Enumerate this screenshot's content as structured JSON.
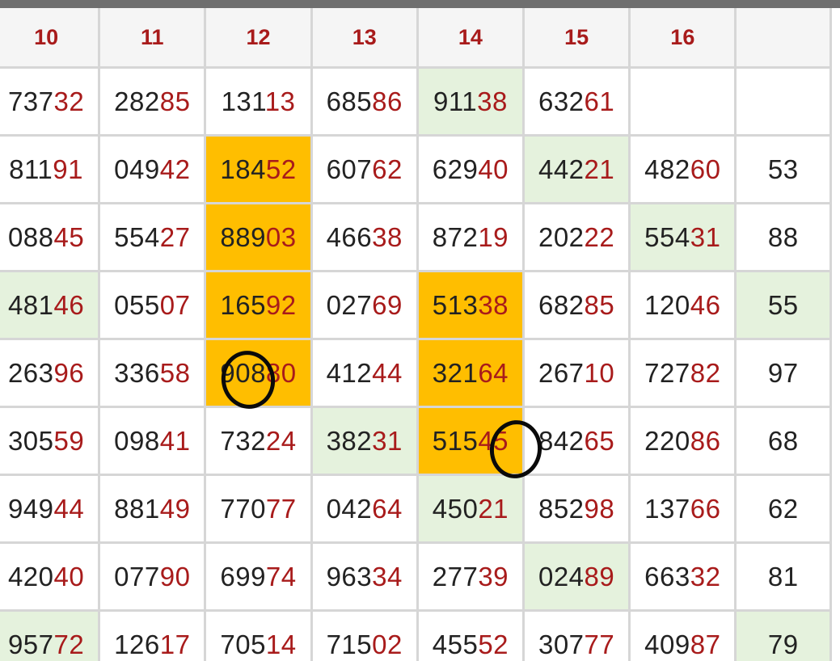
{
  "table": {
    "columns": [
      {
        "label": "10"
      },
      {
        "label": "11"
      },
      {
        "label": "12"
      },
      {
        "label": "13"
      },
      {
        "label": "14"
      },
      {
        "label": "15"
      },
      {
        "label": "16"
      },
      {
        "label": ""
      }
    ],
    "rows": [
      {
        "cells": [
          {
            "head": "737",
            "tail": "32",
            "hl": ""
          },
          {
            "head": "282",
            "tail": "85",
            "hl": ""
          },
          {
            "head": "131",
            "tail": "13",
            "hl": ""
          },
          {
            "head": "685",
            "tail": "86",
            "hl": ""
          },
          {
            "head": "911",
            "tail": "38",
            "hl": "green"
          },
          {
            "head": "632",
            "tail": "61",
            "hl": ""
          },
          {
            "head": "",
            "tail": "",
            "hl": ""
          },
          {
            "head": "",
            "tail": "",
            "hl": ""
          }
        ]
      },
      {
        "cells": [
          {
            "head": "811",
            "tail": "91",
            "hl": ""
          },
          {
            "head": "049",
            "tail": "42",
            "hl": ""
          },
          {
            "head": "184",
            "tail": "52",
            "hl": "orange"
          },
          {
            "head": "607",
            "tail": "62",
            "hl": ""
          },
          {
            "head": "629",
            "tail": "40",
            "hl": ""
          },
          {
            "head": "442",
            "tail": "21",
            "hl": "green"
          },
          {
            "head": "482",
            "tail": "60",
            "hl": ""
          },
          {
            "head": "53",
            "tail": "",
            "hl": ""
          }
        ]
      },
      {
        "cells": [
          {
            "head": "088",
            "tail": "45",
            "hl": ""
          },
          {
            "head": "554",
            "tail": "27",
            "hl": ""
          },
          {
            "head": "889",
            "tail": "03",
            "hl": "orange"
          },
          {
            "head": "466",
            "tail": "38",
            "hl": ""
          },
          {
            "head": "872",
            "tail": "19",
            "hl": ""
          },
          {
            "head": "202",
            "tail": "22",
            "hl": ""
          },
          {
            "head": "554",
            "tail": "31",
            "hl": "green"
          },
          {
            "head": "88",
            "tail": "",
            "hl": ""
          }
        ]
      },
      {
        "cells": [
          {
            "head": "481",
            "tail": "46",
            "hl": "green"
          },
          {
            "head": "055",
            "tail": "07",
            "hl": ""
          },
          {
            "head": "165",
            "tail": "92",
            "hl": "orange"
          },
          {
            "head": "027",
            "tail": "69",
            "hl": ""
          },
          {
            "head": "513",
            "tail": "38",
            "hl": "orange"
          },
          {
            "head": "682",
            "tail": "85",
            "hl": ""
          },
          {
            "head": "120",
            "tail": "46",
            "hl": ""
          },
          {
            "head": "55",
            "tail": "",
            "hl": "green"
          }
        ]
      },
      {
        "cells": [
          {
            "head": "263",
            "tail": "96",
            "hl": ""
          },
          {
            "head": "336",
            "tail": "58",
            "hl": ""
          },
          {
            "head": "908",
            "tail": "80",
            "hl": "orange"
          },
          {
            "head": "412",
            "tail": "44",
            "hl": ""
          },
          {
            "head": "321",
            "tail": "64",
            "hl": "orange"
          },
          {
            "head": "267",
            "tail": "10",
            "hl": ""
          },
          {
            "head": "727",
            "tail": "82",
            "hl": ""
          },
          {
            "head": "97",
            "tail": "",
            "hl": ""
          }
        ]
      },
      {
        "cells": [
          {
            "head": "305",
            "tail": "59",
            "hl": ""
          },
          {
            "head": "098",
            "tail": "41",
            "hl": ""
          },
          {
            "head": "732",
            "tail": "24",
            "hl": ""
          },
          {
            "head": "382",
            "tail": "31",
            "hl": "green"
          },
          {
            "head": "515",
            "tail": "45",
            "hl": "orange"
          },
          {
            "head": "842",
            "tail": "65",
            "hl": ""
          },
          {
            "head": "220",
            "tail": "86",
            "hl": ""
          },
          {
            "head": "68",
            "tail": "",
            "hl": ""
          }
        ]
      },
      {
        "cells": [
          {
            "head": "949",
            "tail": "44",
            "hl": ""
          },
          {
            "head": "881",
            "tail": "49",
            "hl": ""
          },
          {
            "head": "770",
            "tail": "77",
            "hl": ""
          },
          {
            "head": "042",
            "tail": "64",
            "hl": ""
          },
          {
            "head": "450",
            "tail": "21",
            "hl": "green"
          },
          {
            "head": "852",
            "tail": "98",
            "hl": ""
          },
          {
            "head": "137",
            "tail": "66",
            "hl": ""
          },
          {
            "head": "62",
            "tail": "",
            "hl": ""
          }
        ]
      },
      {
        "cells": [
          {
            "head": "420",
            "tail": "40",
            "hl": ""
          },
          {
            "head": "077",
            "tail": "90",
            "hl": ""
          },
          {
            "head": "699",
            "tail": "74",
            "hl": ""
          },
          {
            "head": "963",
            "tail": "34",
            "hl": ""
          },
          {
            "head": "277",
            "tail": "39",
            "hl": ""
          },
          {
            "head": "024",
            "tail": "89",
            "hl": "green"
          },
          {
            "head": "663",
            "tail": "32",
            "hl": ""
          },
          {
            "head": "81",
            "tail": "",
            "hl": ""
          }
        ]
      },
      {
        "cells": [
          {
            "head": "957",
            "tail": "72",
            "hl": "green"
          },
          {
            "head": "126",
            "tail": "17",
            "hl": ""
          },
          {
            "head": "705",
            "tail": "14",
            "hl": ""
          },
          {
            "head": "715",
            "tail": "02",
            "hl": ""
          },
          {
            "head": "455",
            "tail": "52",
            "hl": ""
          },
          {
            "head": "307",
            "tail": "77",
            "hl": ""
          },
          {
            "head": "409",
            "tail": "87",
            "hl": ""
          },
          {
            "head": "79",
            "tail": "",
            "hl": "green"
          }
        ]
      }
    ]
  },
  "colors": {
    "header_text": "#a81b1b",
    "digit_main": "#222222",
    "digit_tail": "#a81b1b",
    "highlight_green": "#e5f2dd",
    "highlight_orange": "#ffbe00",
    "grid_line": "#d6d6d6"
  },
  "annotations": [
    {
      "name": "hand-drawn-circle",
      "row": 5,
      "column": "12"
    },
    {
      "name": "hand-drawn-circle",
      "row": 6,
      "column": "14"
    }
  ]
}
